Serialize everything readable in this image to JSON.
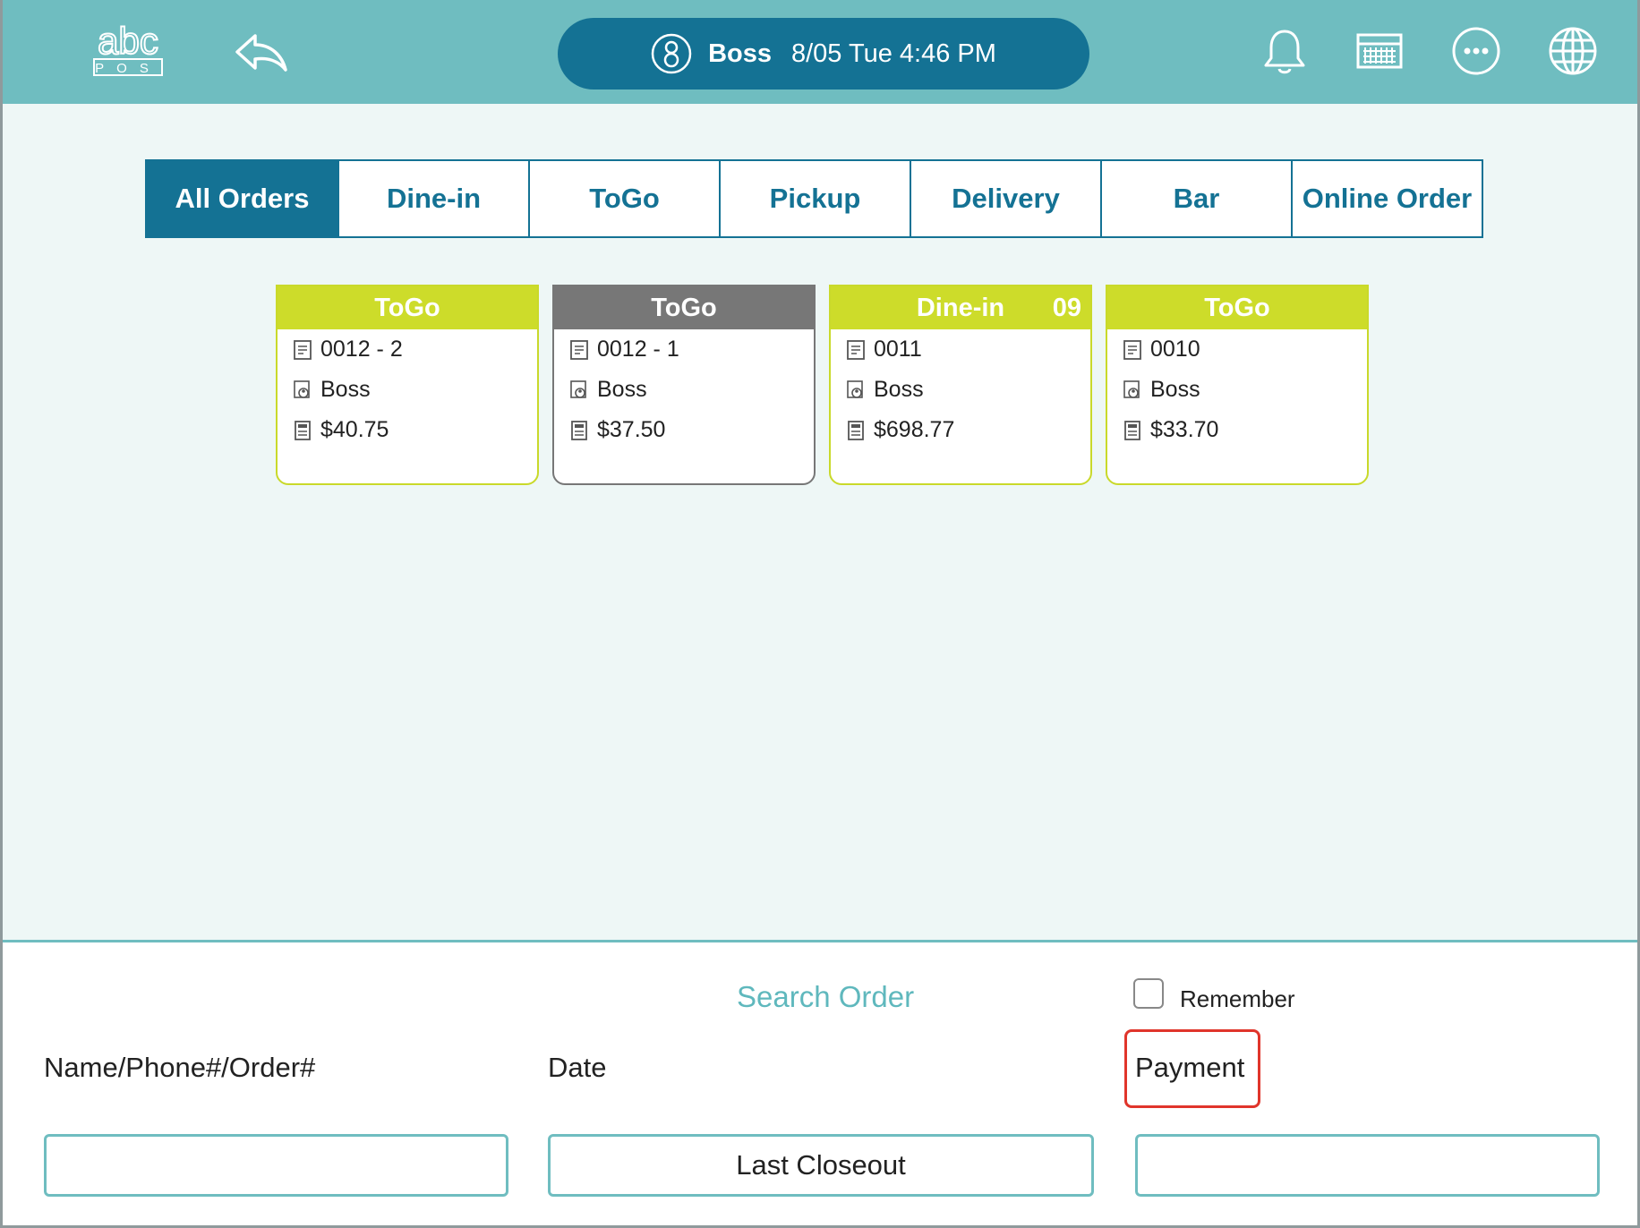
{
  "header": {
    "logo_top": "abc",
    "logo_bottom": "POS",
    "user_name": "Boss",
    "datetime": "8/05 Tue 4:46 PM",
    "icons": [
      "back-arrow-icon",
      "user-icon",
      "bell-icon",
      "calendar-grid-icon",
      "more-icon",
      "globe-icon"
    ]
  },
  "tabs": [
    {
      "label": "All Orders",
      "active": true
    },
    {
      "label": "Dine-in",
      "active": false
    },
    {
      "label": "ToGo",
      "active": false
    },
    {
      "label": "Pickup",
      "active": false
    },
    {
      "label": "Delivery",
      "active": false
    },
    {
      "label": "Bar",
      "active": false
    },
    {
      "label": "Online Order",
      "active": false
    }
  ],
  "orders": [
    {
      "type": "ToGo",
      "table": "",
      "order_no": "0012 - 2",
      "server": "Boss",
      "amount": "$40.75",
      "color": "#cddc2a"
    },
    {
      "type": "ToGo",
      "table": "",
      "order_no": "0012 - 1",
      "server": "Boss",
      "amount": "$37.50",
      "color": "#777777"
    },
    {
      "type": "Dine-in",
      "table": "09",
      "order_no": "0011",
      "server": "Boss",
      "amount": "$698.77",
      "color": "#cddc2a"
    },
    {
      "type": "ToGo",
      "table": "",
      "order_no": "0010",
      "server": "Boss",
      "amount": "$33.70",
      "color": "#cddc2a"
    }
  ],
  "search": {
    "title": "Search Order",
    "remember_label": "Remember",
    "remember_checked": false,
    "name_label": "Name/Phone#/Order#",
    "name_value": "",
    "date_label": "Date",
    "date_value": "Last Closeout",
    "payment_label": "Payment",
    "payment_value": ""
  },
  "colors": {
    "header_bg": "#6fbdc0",
    "primary": "#147294",
    "order_accent": "#cddc2a",
    "order_closed": "#777777",
    "highlight": "#e0352b"
  }
}
